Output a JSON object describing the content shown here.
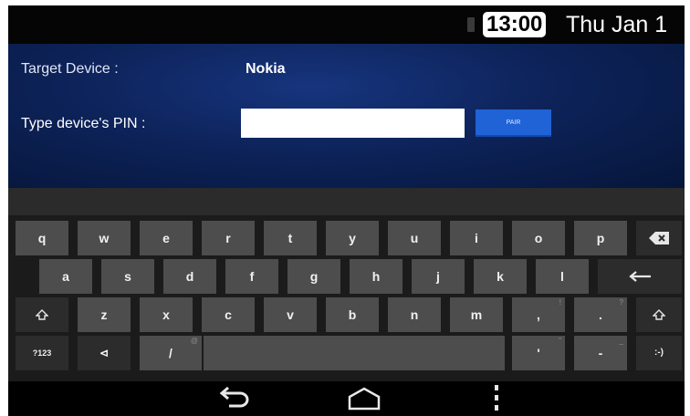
{
  "status_bar": {
    "time": "13:00",
    "date": "Thu Jan 1"
  },
  "dialog": {
    "target_label": "Target Device :",
    "target_value": "Nokia",
    "pin_label": "Type device's PIN :",
    "pin_value": "",
    "pair_button": "PAIR"
  },
  "keyboard": {
    "row1": [
      "q",
      "w",
      "e",
      "r",
      "t",
      "y",
      "u",
      "i",
      "o",
      "p"
    ],
    "row2": [
      "a",
      "s",
      "d",
      "f",
      "g",
      "h",
      "j",
      "k",
      "l"
    ],
    "row3": [
      "z",
      "x",
      "c",
      "v",
      "b",
      "n",
      "m",
      ",",
      "."
    ],
    "symbols_key": "?123",
    "settings_key": "⊲",
    "slash_key": "/",
    "apostrophe_key": "'",
    "minus_key": "-",
    "smiley_key": ":-)"
  },
  "navbar": {
    "icons": [
      "back-icon",
      "home-icon",
      "menu-icon"
    ]
  }
}
